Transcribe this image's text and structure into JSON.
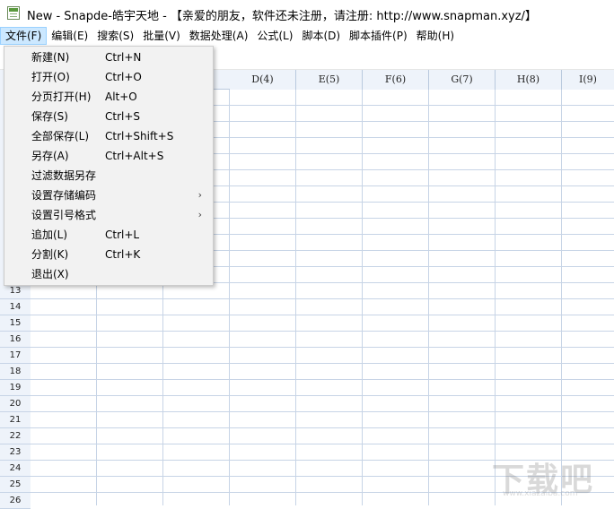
{
  "window": {
    "title": "New - Snapde-皓宇天地 - 【亲爱的朋友，软件还未注册，请注册: http://www.snapman.xyz/】",
    "icon": "spreadsheet-app-icon"
  },
  "menubar": {
    "items": [
      {
        "label": "文件(F)",
        "active": true
      },
      {
        "label": "编辑(E)"
      },
      {
        "label": "搜索(S)"
      },
      {
        "label": "批量(V)"
      },
      {
        "label": "数据处理(A)"
      },
      {
        "label": "公式(L)"
      },
      {
        "label": "脚本(D)"
      },
      {
        "label": "脚本插件(P)"
      },
      {
        "label": "帮助(H)"
      }
    ]
  },
  "file_menu": {
    "items": [
      {
        "label": "新建(N)",
        "shortcut": "Ctrl+N"
      },
      {
        "label": "打开(O)",
        "shortcut": "Ctrl+O"
      },
      {
        "label": "分页打开(H)",
        "shortcut": "Alt+O"
      },
      {
        "label": "保存(S)",
        "shortcut": "Ctrl+S"
      },
      {
        "label": "全部保存(L)",
        "shortcut": "Ctrl+Shift+S"
      },
      {
        "label": "另存(A)",
        "shortcut": "Ctrl+Alt+S"
      },
      {
        "label": "过滤数据另存",
        "shortcut": ""
      },
      {
        "label": "设置存储编码",
        "shortcut": "",
        "submenu": true
      },
      {
        "label": "设置引号格式",
        "shortcut": "",
        "submenu": true
      },
      {
        "label": "追加(L)",
        "shortcut": "Ctrl+L"
      },
      {
        "label": "分割(K)",
        "shortcut": "Ctrl+K"
      },
      {
        "label": "退出(X)",
        "shortcut": ""
      }
    ],
    "submenu_arrow": "›"
  },
  "grid": {
    "columns": [
      "D(4)",
      "E(5)",
      "F(6)",
      "G(7)",
      "H(8)",
      "I(9)"
    ],
    "rows": [
      "13",
      "14",
      "15",
      "16",
      "17",
      "18",
      "19",
      "20",
      "21",
      "22",
      "23",
      "24",
      "25",
      "26"
    ]
  },
  "watermark": {
    "text": "下载吧",
    "url": "www.xiazaiba.com"
  },
  "colors": {
    "menu_active_bg": "#cce8ff",
    "header_bg": "#eef3fa",
    "grid_line": "#c7d4e6",
    "dropdown_bg": "#f2f2f2"
  }
}
